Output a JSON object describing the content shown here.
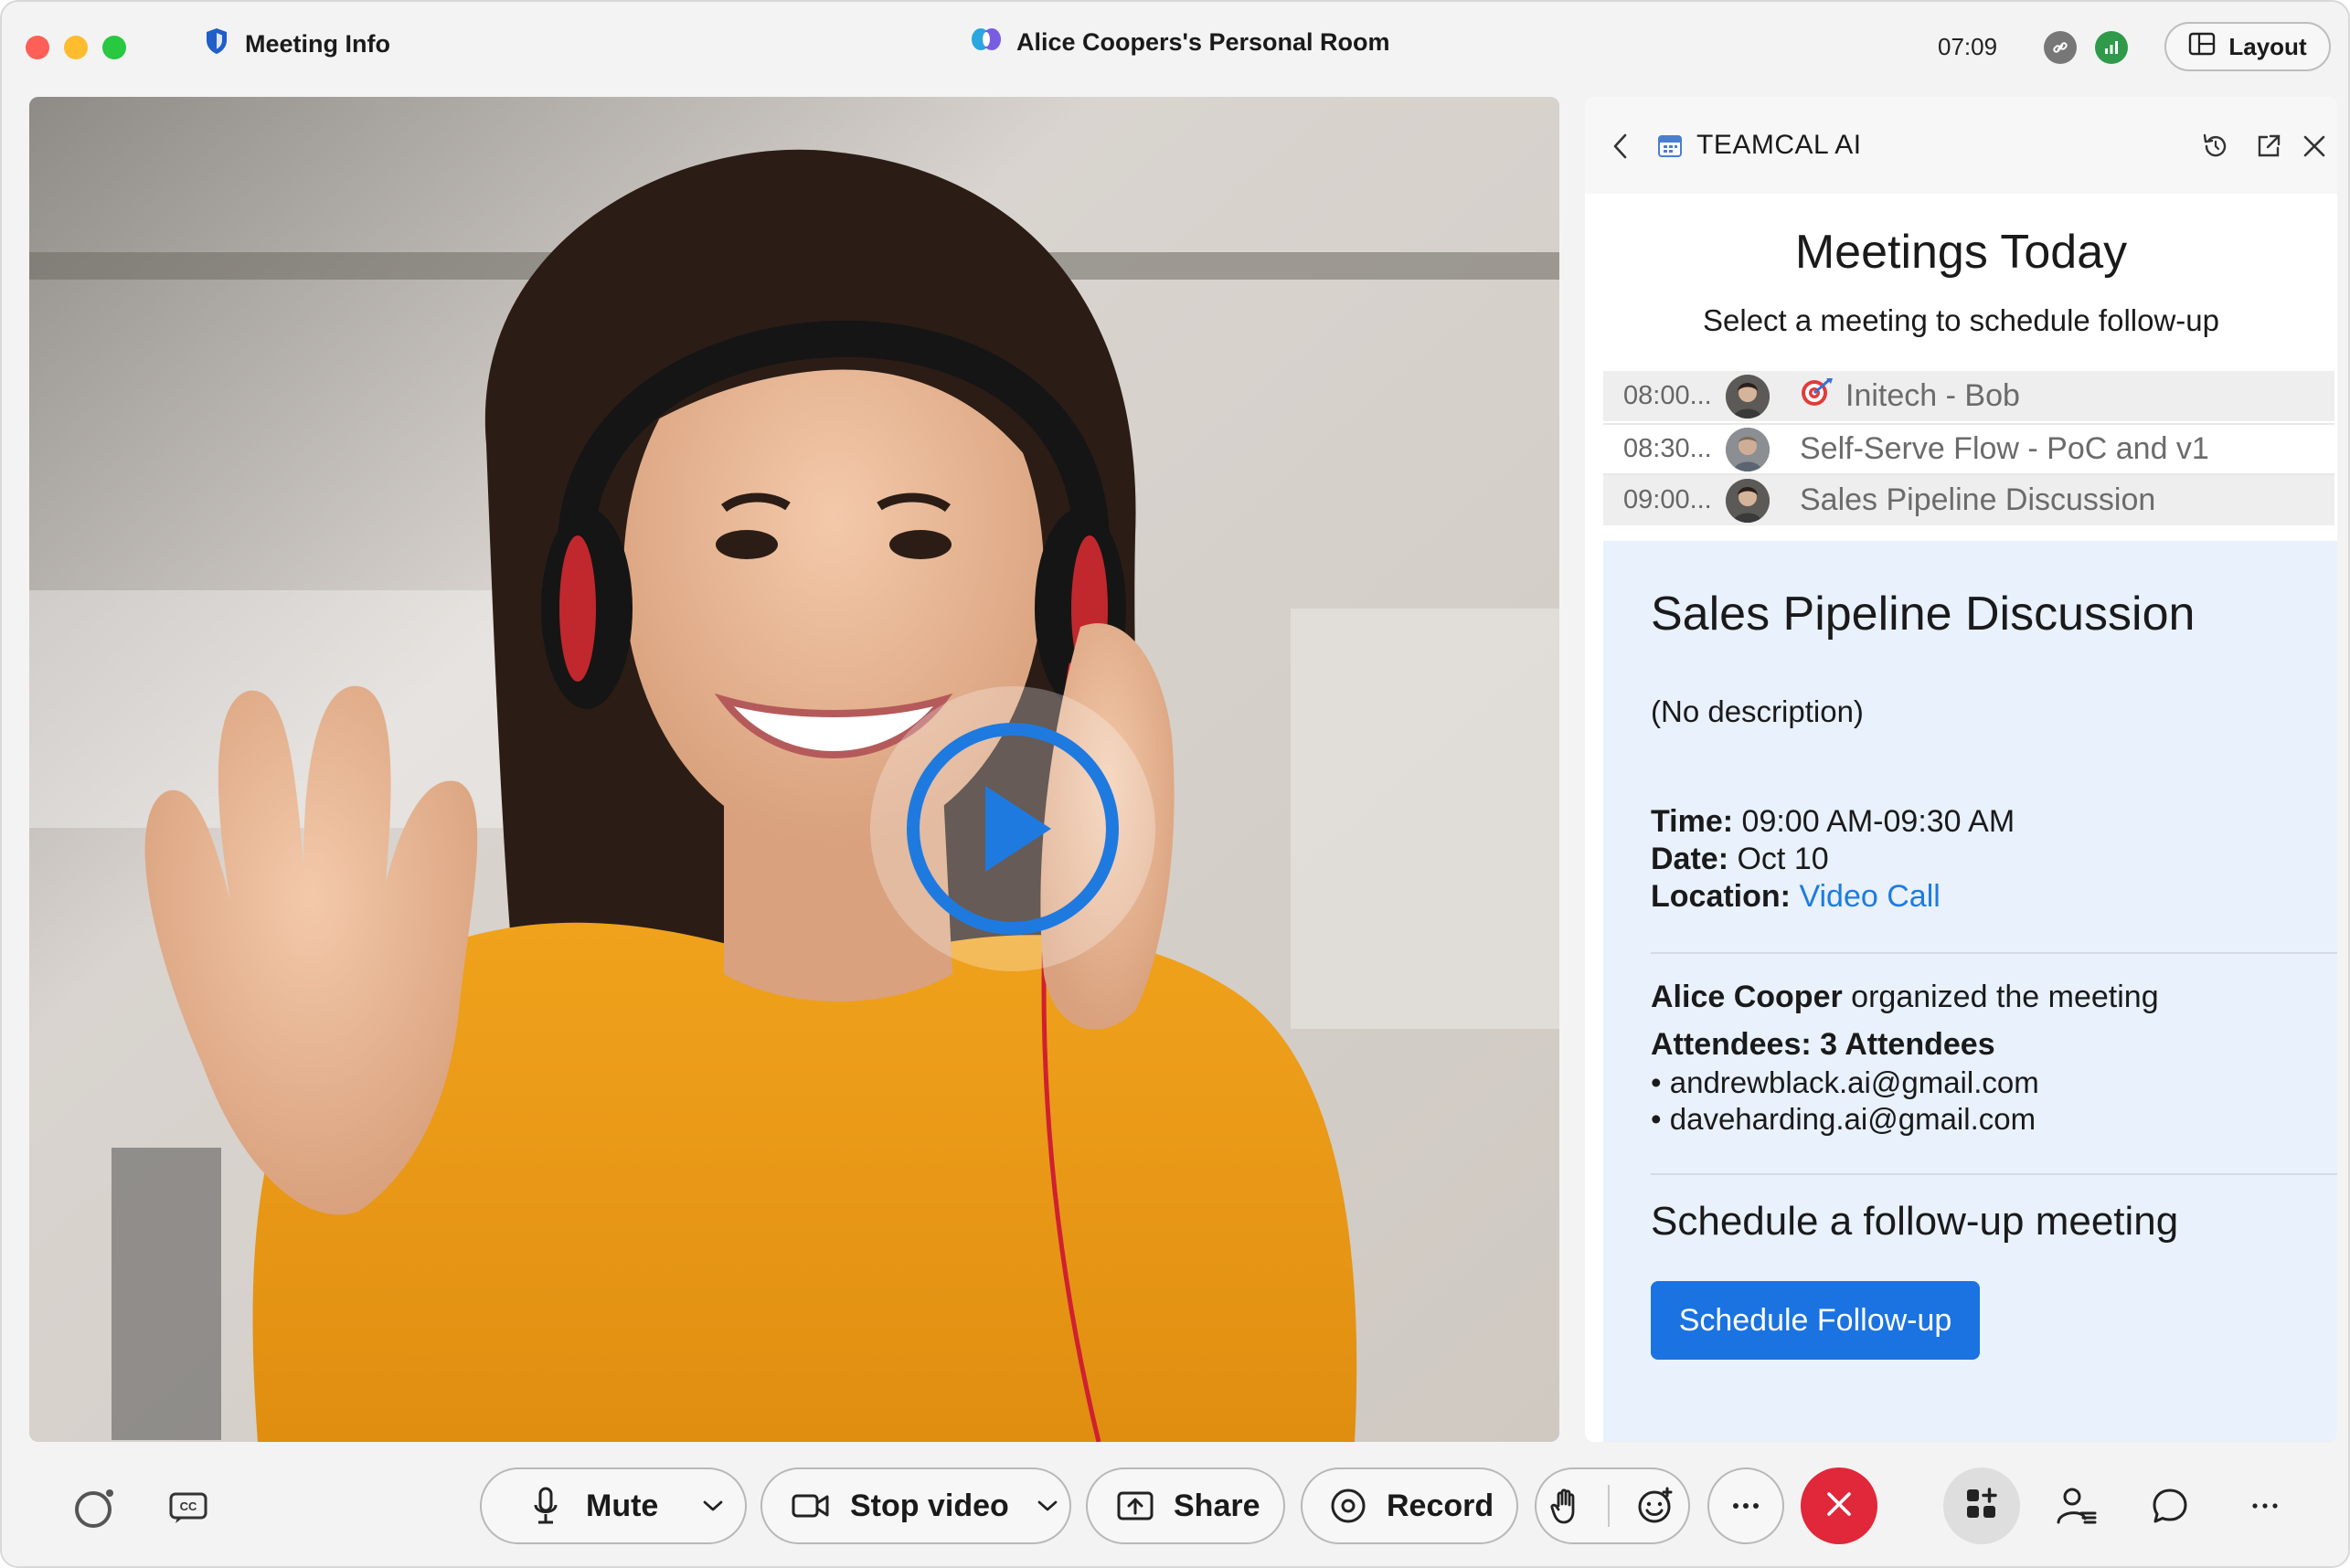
{
  "titlebar": {
    "meeting_info": "Meeting Info",
    "room_title": "Alice Coopers's Personal Room",
    "clock": "07:09",
    "layout_label": "Layout"
  },
  "panel": {
    "app_name": "TEAMCAL AI",
    "heading": "Meetings Today",
    "subheading": "Select a meeting to schedule follow-up",
    "meetings": [
      {
        "time": "08:00...",
        "title": "Initech - Bob",
        "has_target_icon": true
      },
      {
        "time": "08:30...",
        "title": "Self-Serve Flow - PoC and v1"
      },
      {
        "time": "09:00...",
        "title": "Sales Pipeline Discussion"
      }
    ],
    "detail": {
      "title": "Sales Pipeline Discussion",
      "description": "(No description)",
      "time_label": "Time:",
      "time_value": "09:00 AM-09:30 AM",
      "date_label": "Date:",
      "date_value": "Oct 10",
      "location_label": "Location:",
      "location_value": "Video Call",
      "organizer_name": "Alice Cooper",
      "organizer_suffix": "organized the meeting",
      "attendees_label": "Attendees: 3 Attendees",
      "attendees": [
        "andrewblack.ai@gmail.com",
        "daveharding.ai@gmail.com"
      ],
      "followup_heading": "Schedule a follow-up meeting",
      "followup_button": "Schedule Follow-up"
    }
  },
  "toolbar": {
    "mute_label": "Mute",
    "stop_video_label": "Stop video",
    "share_label": "Share",
    "record_label": "Record"
  },
  "colors": {
    "accent_blue": "#1a73e0",
    "end_call_red": "#e0283a",
    "detail_bg": "#e8f1fc"
  }
}
